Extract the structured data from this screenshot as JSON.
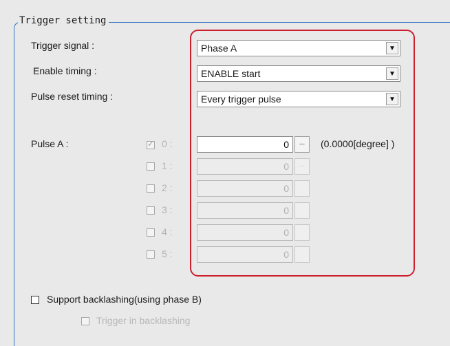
{
  "group": {
    "title": "Trigger setting"
  },
  "fields": {
    "trigger_signal": {
      "label": "Trigger signal :",
      "value": "Phase A"
    },
    "enable_timing": {
      "label": "Enable timing :",
      "value": "ENABLE start"
    },
    "pulse_reset_timing": {
      "label": "Pulse reset timing :",
      "value": "Every trigger pulse"
    }
  },
  "pulse_a": {
    "label": "Pulse A :",
    "rows": [
      {
        "index_label": "0 :",
        "value": "0",
        "button": "...",
        "checked": true,
        "enabled": true
      },
      {
        "index_label": "1 :",
        "value": "0",
        "button": "...",
        "checked": false,
        "enabled": false
      },
      {
        "index_label": "2 :",
        "value": "0",
        "button": "",
        "checked": false,
        "enabled": false
      },
      {
        "index_label": "3 :",
        "value": "0",
        "button": "",
        "checked": false,
        "enabled": false
      },
      {
        "index_label": "4 :",
        "value": "0",
        "button": "",
        "checked": false,
        "enabled": false
      },
      {
        "index_label": "5 :",
        "value": "0",
        "button": "",
        "checked": false,
        "enabled": false
      }
    ],
    "degree_text": "(0.0000[degree] )"
  },
  "options": {
    "support_backlashing": {
      "label": "Support backlashing(using phase B)",
      "checked": false
    },
    "trigger_in_backlashing": {
      "label": "Trigger in backlashing",
      "checked": false,
      "enabled": false
    }
  },
  "colors": {
    "highlight_border": "#cc1f2e",
    "group_border": "#2f6fc0",
    "background": "#e9e9e9"
  },
  "icons": {
    "dropdown": "chevron-down-icon",
    "checkbox": "checkbox-icon"
  }
}
